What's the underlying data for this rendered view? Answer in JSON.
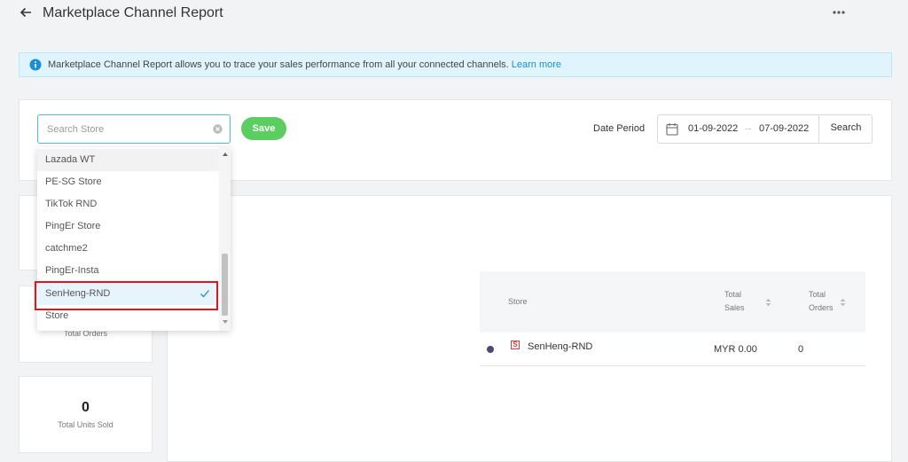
{
  "header": {
    "title": "Marketplace Channel Report",
    "back_icon": "arrow-left-icon",
    "more_icon": "more-horizontal-icon"
  },
  "banner": {
    "icon": "info-icon",
    "text": "Marketplace Channel Report allows you to trace your sales performance from all your connected channels. ",
    "link": "Learn more"
  },
  "filters": {
    "search_placeholder": "Search Store",
    "save_label": "Save",
    "date_period_label": "Date Period",
    "date_start": "01-09-2022",
    "date_separator": "→",
    "date_end": "07-09-2022",
    "search_button": "Search"
  },
  "dropdown": {
    "items": [
      {
        "label": "Lazada WT"
      },
      {
        "label": "PE-SG Store"
      },
      {
        "label": "TikTok RND"
      },
      {
        "label": "PingEr Store"
      },
      {
        "label": "catchme2"
      },
      {
        "label": "PingEr-Insta"
      },
      {
        "label": "SenHeng-RND",
        "selected": true
      },
      {
        "label": "Store"
      }
    ]
  },
  "stats": {
    "orders_label": "Total Orders",
    "units_value": "0",
    "units_label": "Total Units Sold"
  },
  "table": {
    "headers": {
      "store": "Store",
      "sales_line1": "Total",
      "sales_line2": "Sales",
      "orders_line1": "Total",
      "orders_line2": "Orders"
    },
    "rows": [
      {
        "store": "SenHeng-RND",
        "sales": "MYR 0.00",
        "orders": "0",
        "dot_color": "#4d4a72"
      }
    ]
  },
  "colors": {
    "accent": "#1a8fd6",
    "save_green": "#5ccd61",
    "highlight_red": "#e0161c"
  }
}
